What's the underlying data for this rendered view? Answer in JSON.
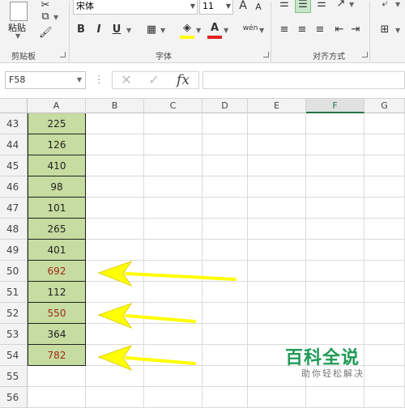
{
  "ribbon": {
    "clipboard": {
      "paste_label": "粘贴",
      "group_label": "剪贴板"
    },
    "font": {
      "font_name": "宋体",
      "font_size": "11",
      "bold": "B",
      "italic": "I",
      "underline": "U",
      "grow": "A",
      "shrink": "A",
      "phonetic": "wén",
      "group_label": "字体"
    },
    "alignment": {
      "group_label": "对齐方式"
    }
  },
  "formula_bar": {
    "name_box": "F58",
    "cancel_icon": "✕",
    "enter_icon": "✓",
    "fx_label": "fx",
    "formula_value": ""
  },
  "sheet": {
    "columns": [
      "A",
      "B",
      "C",
      "D",
      "E",
      "F",
      "G"
    ],
    "active_column": "F",
    "rows": [
      {
        "num": "43",
        "a": "225",
        "highlight": false
      },
      {
        "num": "44",
        "a": "126",
        "highlight": false
      },
      {
        "num": "45",
        "a": "410",
        "highlight": false
      },
      {
        "num": "46",
        "a": "98",
        "highlight": false
      },
      {
        "num": "47",
        "a": "101",
        "highlight": false
      },
      {
        "num": "48",
        "a": "265",
        "highlight": false
      },
      {
        "num": "49",
        "a": "401",
        "highlight": false
      },
      {
        "num": "50",
        "a": "692",
        "highlight": true
      },
      {
        "num": "51",
        "a": "112",
        "highlight": false
      },
      {
        "num": "52",
        "a": "550",
        "highlight": true
      },
      {
        "num": "53",
        "a": "364",
        "highlight": false
      },
      {
        "num": "54",
        "a": "782",
        "highlight": true
      },
      {
        "num": "55",
        "a": "",
        "highlight": false
      },
      {
        "num": "56",
        "a": "",
        "highlight": false
      }
    ]
  },
  "annotations": {
    "arrow_color": "#ffff00",
    "arrow_count": 3,
    "arrow_targets": [
      "50",
      "52",
      "54"
    ]
  },
  "watermark": {
    "title": "百科全说",
    "subtitle": "助你轻松解决"
  },
  "colors": {
    "fill_a": "#c6dca0",
    "highlight_text": "#a02a1a",
    "active_header": "#217346",
    "watermark_green": "#1e9a55"
  }
}
